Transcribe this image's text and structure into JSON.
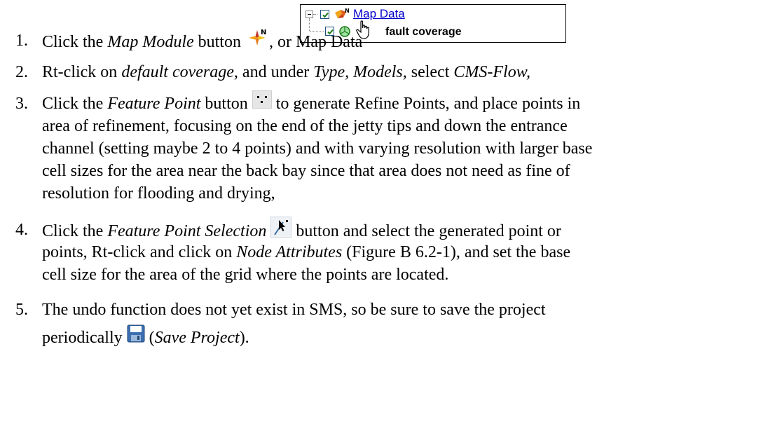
{
  "tree": {
    "map_data_label": "Map Data",
    "coverage_label": "fault coverage"
  },
  "steps": [
    {
      "number": "1.",
      "lines": [
        {
          "pre": "Click the ",
          "em1": "Map Module",
          "mid": " button ",
          "post": ", or Map Data"
        }
      ]
    },
    {
      "number": "2.",
      "lines": [
        {
          "a": "Rt-click on ",
          "b": "default coverage",
          "c": ", and under ",
          "d": "Type",
          "e": ", ",
          "f": "Models",
          "g": ", select ",
          "h": "CMS-Flow,"
        }
      ]
    },
    {
      "number": "3.",
      "lines": [
        {
          "a": "Click the ",
          "b": "Feature Point",
          "c": " button ",
          "d": " to generate Refine Points, and place points in"
        },
        "area of refinement, focusing on the end of the jetty tips and down the entrance",
        "channel (setting maybe 2 to 4 points) and with varying resolution with larger base",
        "cell sizes for the area near the back bay since that area does not need as fine of",
        "resolution for flooding and drying,"
      ]
    },
    {
      "number": "4.",
      "lines": [
        {
          "a": "Click the ",
          "b": "Feature Point Selection",
          "c": " ",
          "d": " button and select the generated point or"
        },
        {
          "a": "points, Rt-click and click on ",
          "b": "Node Attributes",
          "c": " (Figure B 6.2-1), and set the base"
        },
        "cell size for the area of the grid where the points are located."
      ]
    },
    {
      "number": "5.",
      "lines": [
        "The undo function does not yet exist in SMS, so be sure to save the project",
        {
          "a": "periodically ",
          "b": " (",
          "c": "Save Project",
          "d": ")."
        }
      ]
    }
  ]
}
